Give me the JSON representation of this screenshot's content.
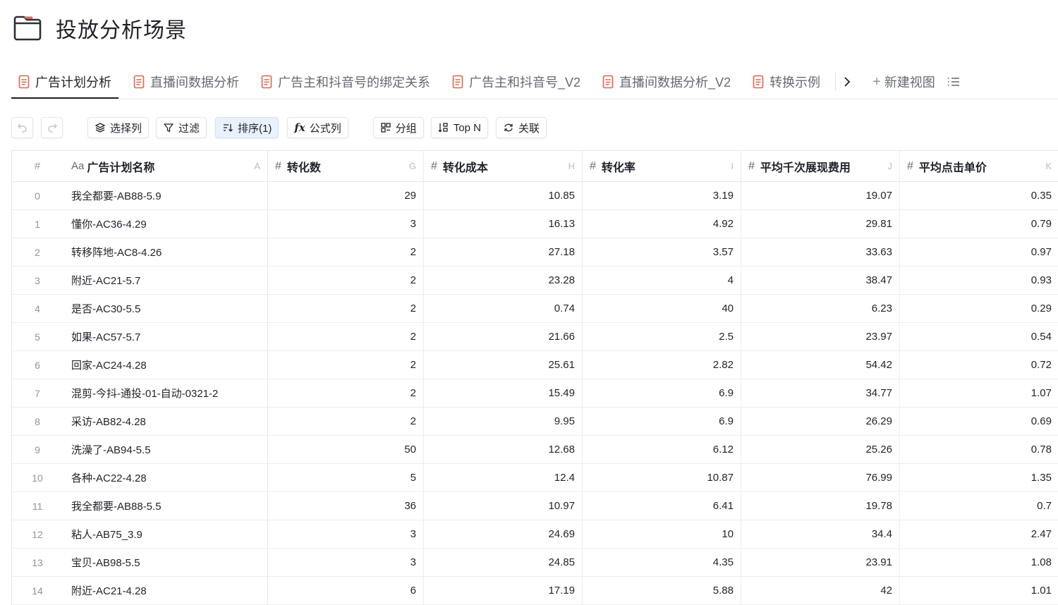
{
  "page": {
    "title": "投放分析场景",
    "folder_icon": "folder-icon"
  },
  "tabs": [
    {
      "label": "广告计划分析",
      "active": true
    },
    {
      "label": "直播间数据分析"
    },
    {
      "label": "广告主和抖音号的绑定关系"
    },
    {
      "label": "广告主和抖音号_V2"
    },
    {
      "label": "直播间数据分析_V2"
    },
    {
      "label": "转换示例"
    }
  ],
  "new_view_label": "新建视图",
  "toolbar": {
    "select_columns": "选择列",
    "filter": "过滤",
    "sort": "排序(1)",
    "formula": "公式列",
    "group": "分组",
    "topn": "Top N",
    "relate": "关联"
  },
  "table": {
    "index_header": "#",
    "columns": [
      {
        "label": "广告计划名称",
        "letter": "A",
        "type": "text"
      },
      {
        "label": "转化数",
        "letter": "G",
        "type": "number"
      },
      {
        "label": "转化成本",
        "letter": "H",
        "type": "number"
      },
      {
        "label": "转化率",
        "letter": "I",
        "type": "number"
      },
      {
        "label": "平均千次展现费用",
        "letter": "J",
        "type": "number"
      },
      {
        "label": "平均点击单价",
        "letter": "K",
        "type": "number"
      }
    ],
    "rows": [
      [
        "0",
        "我全都要-AB88-5.9",
        "29",
        "10.85",
        "3.19",
        "19.07",
        "0.35"
      ],
      [
        "1",
        "懂你-AC36-4.29",
        "3",
        "16.13",
        "4.92",
        "29.81",
        "0.79"
      ],
      [
        "2",
        "转移阵地-AC8-4.26",
        "2",
        "27.18",
        "3.57",
        "33.63",
        "0.97"
      ],
      [
        "3",
        "附近-AC21-5.7",
        "2",
        "23.28",
        "4",
        "38.47",
        "0.93"
      ],
      [
        "4",
        "是否-AC30-5.5",
        "2",
        "0.74",
        "40",
        "6.23",
        "0.29"
      ],
      [
        "5",
        "如果-AC57-5.7",
        "2",
        "21.66",
        "2.5",
        "23.97",
        "0.54"
      ],
      [
        "6",
        "回家-AC24-4.28",
        "2",
        "25.61",
        "2.82",
        "54.42",
        "0.72"
      ],
      [
        "7",
        "混剪-今抖-通投-01-自动-0321-2",
        "2",
        "15.49",
        "6.9",
        "34.77",
        "1.07"
      ],
      [
        "8",
        "采访-AB82-4.28",
        "2",
        "9.95",
        "6.9",
        "26.29",
        "0.69"
      ],
      [
        "9",
        "洗澡了-AB94-5.5",
        "50",
        "12.68",
        "6.12",
        "25.26",
        "0.78"
      ],
      [
        "10",
        "各种-AC22-4.28",
        "5",
        "12.4",
        "10.87",
        "76.99",
        "1.35"
      ],
      [
        "11",
        "我全都要-AB88-5.5",
        "36",
        "10.97",
        "6.41",
        "19.78",
        "0.7"
      ],
      [
        "12",
        "粘人-AB75_3.9",
        "3",
        "24.69",
        "10",
        "34.4",
        "2.47"
      ],
      [
        "13",
        "宝贝-AB98-5.5",
        "3",
        "24.85",
        "4.35",
        "23.91",
        "1.08"
      ],
      [
        "14",
        "附近-AC21-4.28",
        "6",
        "17.19",
        "5.88",
        "42",
        "1.01"
      ]
    ]
  },
  "colors": {
    "doc_icon_accent": "#e8604c",
    "active_tab_underline": "#1f2329",
    "sort_active_bg": "#e9f1fd"
  }
}
